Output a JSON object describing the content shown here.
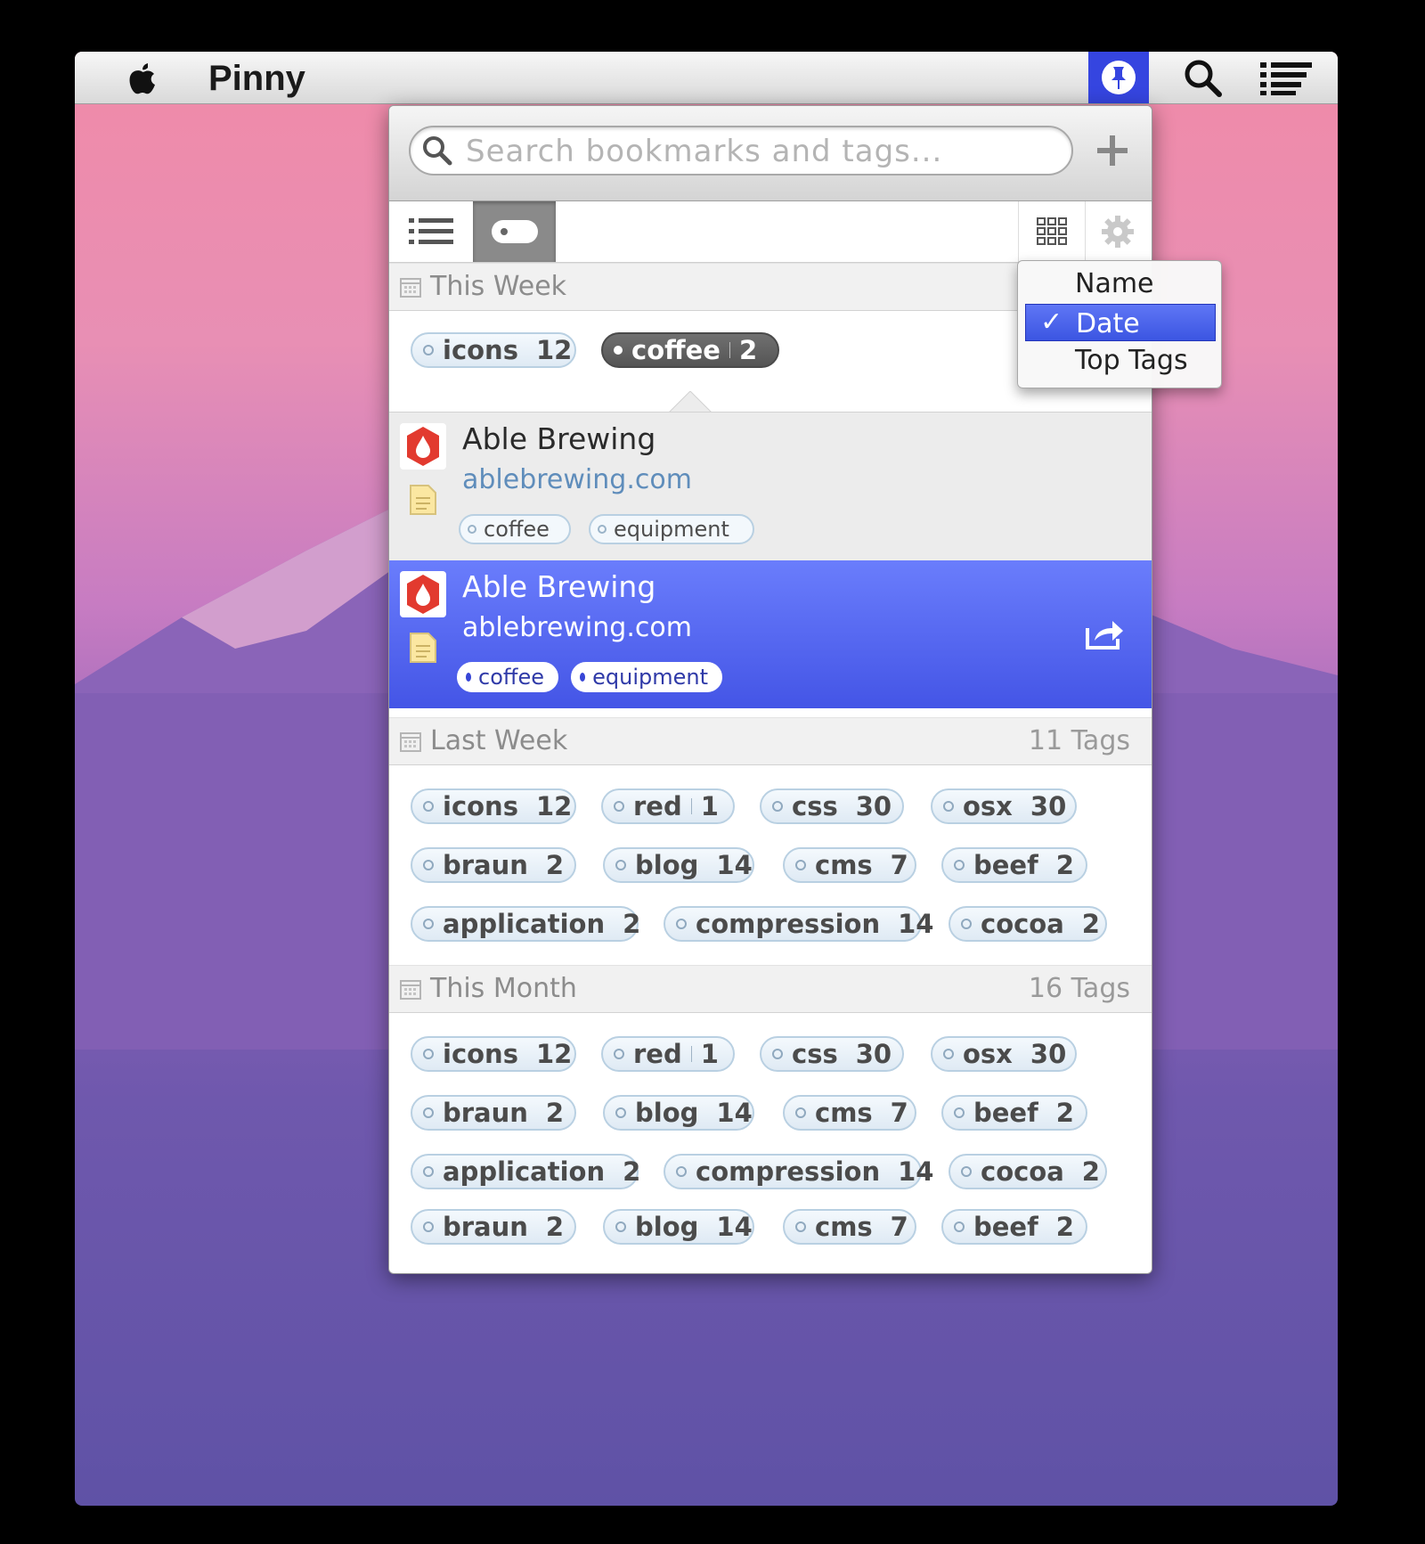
{
  "menubar": {
    "app_name": "Pinny"
  },
  "search": {
    "placeholder": "Search bookmarks and tags..."
  },
  "sort_menu": {
    "items": [
      {
        "label": "Name",
        "checked": false
      },
      {
        "label": "Date",
        "checked": true,
        "check_mark": "✓"
      },
      {
        "label": "Top Tags",
        "checked": false
      }
    ]
  },
  "sections": {
    "this_week": {
      "title": "This Week",
      "tags": [
        {
          "name": "icons",
          "count": "12"
        },
        {
          "name": "coffee",
          "count": "2",
          "selected": true
        }
      ]
    },
    "last_week": {
      "title": "Last Week",
      "count_label": "11 Tags",
      "tags": [
        {
          "name": "icons",
          "count": "12"
        },
        {
          "name": "red",
          "count": "1"
        },
        {
          "name": "css",
          "count": "30"
        },
        {
          "name": "osx",
          "count": "30"
        },
        {
          "name": "braun",
          "count": "2"
        },
        {
          "name": "blog",
          "count": "14"
        },
        {
          "name": "cms",
          "count": "7"
        },
        {
          "name": "beef",
          "count": "2"
        },
        {
          "name": "application",
          "count": "2"
        },
        {
          "name": "compression",
          "count": "14"
        },
        {
          "name": "cocoa",
          "count": "2"
        }
      ]
    },
    "this_month": {
      "title": "This Month",
      "count_label": "16 Tags",
      "tags": [
        {
          "name": "icons",
          "count": "12"
        },
        {
          "name": "red",
          "count": "1"
        },
        {
          "name": "css",
          "count": "30"
        },
        {
          "name": "osx",
          "count": "30"
        },
        {
          "name": "braun",
          "count": "2"
        },
        {
          "name": "blog",
          "count": "14"
        },
        {
          "name": "cms",
          "count": "7"
        },
        {
          "name": "beef",
          "count": "2"
        },
        {
          "name": "application",
          "count": "2"
        },
        {
          "name": "compression",
          "count": "14"
        },
        {
          "name": "cocoa",
          "count": "2"
        },
        {
          "name": "braun",
          "count": "2"
        },
        {
          "name": "blog",
          "count": "14"
        },
        {
          "name": "cms",
          "count": "7"
        },
        {
          "name": "beef",
          "count": "2"
        }
      ]
    }
  },
  "bookmarks": [
    {
      "title": "Able Brewing",
      "url": "ablebrewing.com",
      "tags": [
        "coffee",
        "equipment"
      ],
      "selected": false
    },
    {
      "title": "Able Brewing",
      "url": "ablebrewing.com",
      "tags": [
        "coffee",
        "equipment"
      ],
      "selected": true
    }
  ],
  "colors": {
    "selection": "#4455e6",
    "tray_highlight": "#3545e0",
    "tag_border": "#b9d0e2"
  }
}
